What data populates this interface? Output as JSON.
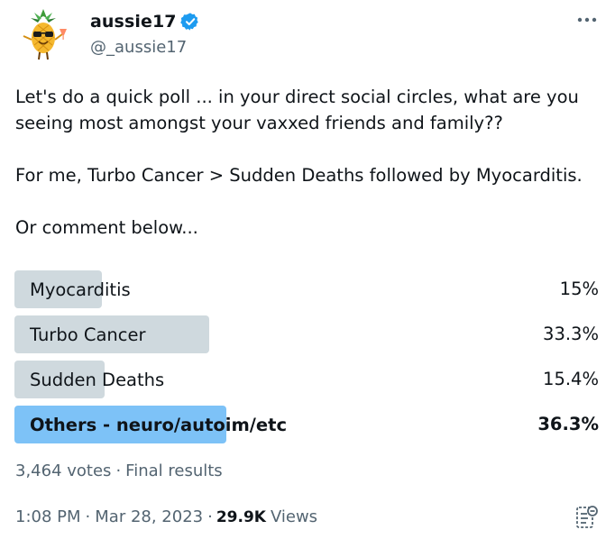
{
  "colors": {
    "text_primary": "#0f1419",
    "text_secondary": "#536471",
    "poll_bar": "#cfd9de",
    "poll_bar_winner": "#7dc2f7",
    "verified": "#1d9bf0"
  },
  "author": {
    "display_name": "aussie17",
    "handle": "@_aussie17",
    "avatar_icon": "pineapple-avatar-icon",
    "verified_icon": "verified-badge-icon"
  },
  "tweet": {
    "text": "Let's do a quick poll ... in your direct social circles, what are you seeing most amongst your vaxxed friends and family??\n\nFor me, Turbo Cancer > Sudden Deaths followed by Myocarditis.\n\nOr comment below..."
  },
  "poll": {
    "options": [
      {
        "label": "Myocarditis",
        "percent_text": "15%",
        "percent": 15.0,
        "winner": false
      },
      {
        "label": "Turbo Cancer",
        "percent_text": "33.3%",
        "percent": 33.3,
        "winner": false
      },
      {
        "label": "Sudden Deaths",
        "percent_text": "15.4%",
        "percent": 15.4,
        "winner": false
      },
      {
        "label": "Others - neuro/autoim/etc",
        "percent_text": "36.3%",
        "percent": 36.3,
        "winner": true
      }
    ],
    "votes_text": "3,464 votes",
    "status_text": "Final results"
  },
  "meta": {
    "time": "1:08 PM",
    "date": "Mar 28, 2023",
    "views_count": "29.9K",
    "views_label": "Views"
  },
  "icons": {
    "more": "more-options-icon",
    "analytics": "post-analytics-icon"
  }
}
